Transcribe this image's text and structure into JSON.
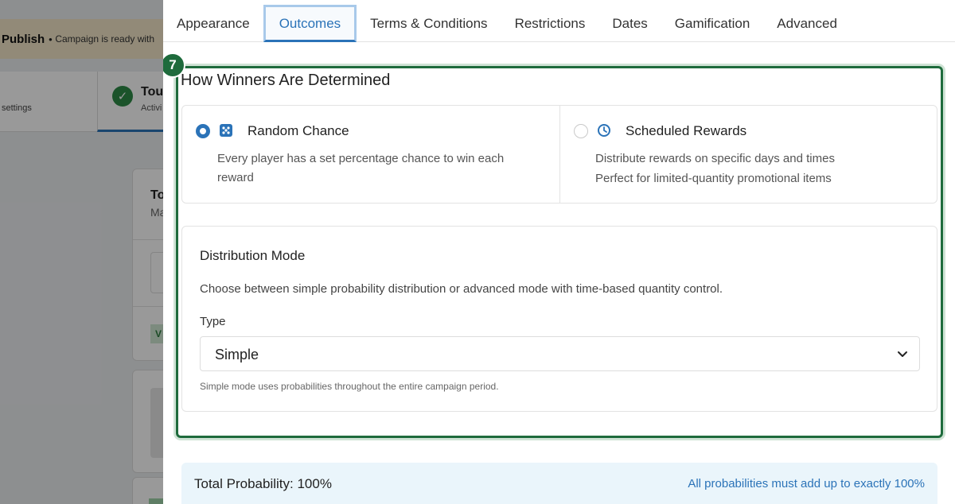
{
  "background": {
    "publish_label": "Publish",
    "publish_message": "Campaign is ready with",
    "step_settings_label": "settings",
    "active_step_title": "Tou",
    "active_step_sub": "Activi",
    "card_title": "To",
    "card_sub": "Ma",
    "tag_label": "V"
  },
  "tabs": [
    {
      "label": "Appearance"
    },
    {
      "label": "Outcomes",
      "active": true
    },
    {
      "label": "Terms & Conditions"
    },
    {
      "label": "Restrictions"
    },
    {
      "label": "Dates"
    },
    {
      "label": "Gamification"
    },
    {
      "label": "Advanced"
    }
  ],
  "section": {
    "step_number": "7",
    "title": "How Winners Are Determined",
    "options": [
      {
        "icon": "dice-icon",
        "title": "Random Chance",
        "selected": true,
        "description": "Every player has a set percentage chance to win each reward"
      },
      {
        "icon": "clock-icon",
        "title": "Scheduled Rewards",
        "selected": false,
        "description": "Distribute rewards on specific days and times",
        "description2": "Perfect for limited-quantity promotional items"
      }
    ]
  },
  "distribution": {
    "title": "Distribution Mode",
    "description": "Choose between simple probability distribution or advanced mode with time-based quantity control.",
    "type_label": "Type",
    "type_value": "Simple",
    "helper": "Simple mode uses probabilities throughout the entire campaign period."
  },
  "total": {
    "label": "Total Probability: 100%",
    "note": "All probabilities must add up to exactly 100%"
  },
  "colors": {
    "accent": "#2b73b8",
    "highlight_border": "#1e6b3c"
  }
}
